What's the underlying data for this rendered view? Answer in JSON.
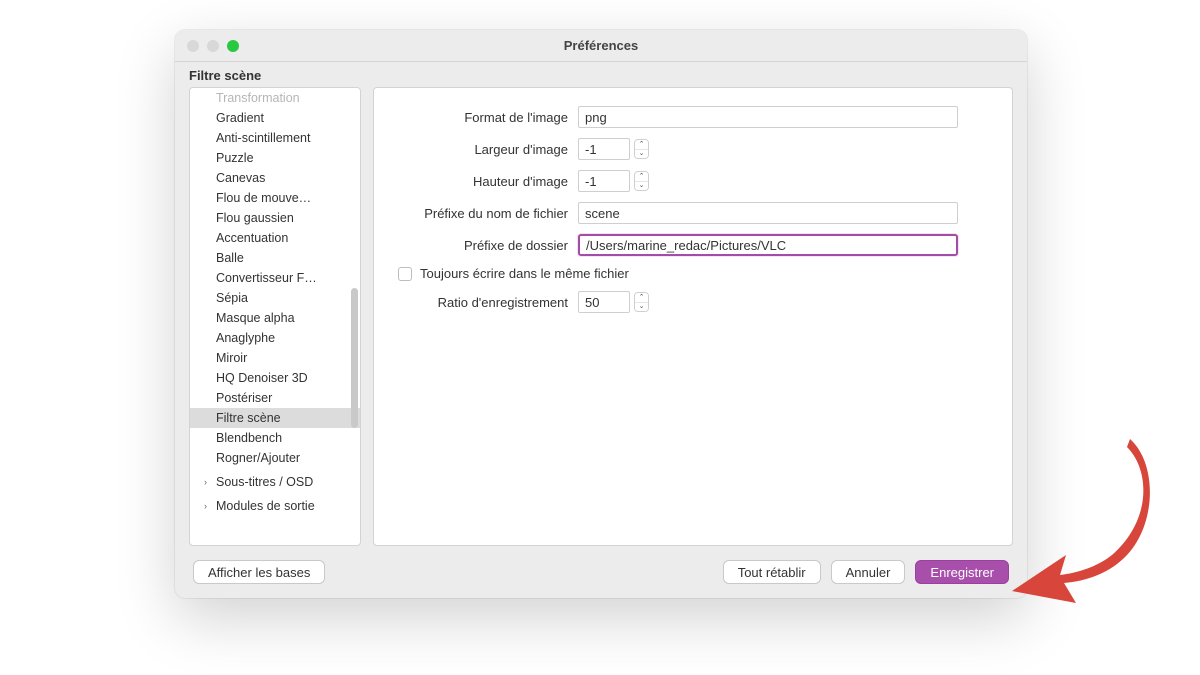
{
  "window": {
    "title": "Préférences",
    "panel_title": "Filtre scène"
  },
  "sidebar": {
    "items": [
      {
        "label": "Transformation",
        "faded": true
      },
      {
        "label": "Gradient"
      },
      {
        "label": "Anti-scintillement"
      },
      {
        "label": "Puzzle"
      },
      {
        "label": "Canevas"
      },
      {
        "label": "Flou de mouve…"
      },
      {
        "label": "Flou gaussien"
      },
      {
        "label": "Accentuation"
      },
      {
        "label": "Balle"
      },
      {
        "label": "Convertisseur F…"
      },
      {
        "label": "Sépia"
      },
      {
        "label": "Masque alpha"
      },
      {
        "label": "Anaglyphe"
      },
      {
        "label": "Miroir"
      },
      {
        "label": "HQ Denoiser 3D"
      },
      {
        "label": "Postériser"
      },
      {
        "label": "Filtre scène",
        "selected": true
      },
      {
        "label": "Blendbench"
      },
      {
        "label": "Rogner/Ajouter"
      }
    ],
    "groups": [
      {
        "label": "Sous-titres / OSD"
      },
      {
        "label": "Modules de sortie"
      }
    ]
  },
  "form": {
    "image_format": {
      "label": "Format de l'image",
      "value": "png"
    },
    "image_width": {
      "label": "Largeur d'image",
      "value": "-1"
    },
    "image_height": {
      "label": "Hauteur d'image",
      "value": "-1"
    },
    "filename_prefix": {
      "label": "Préfixe du nom de fichier",
      "value": "scene"
    },
    "dir_prefix": {
      "label": "Préfixe de dossier",
      "value": "/Users/marine_redac/Pictures/VLC"
    },
    "always_write": {
      "label": "Toujours écrire dans le même fichier",
      "checked": false
    },
    "record_ratio": {
      "label": "Ratio d'enregistrement",
      "value": "50"
    }
  },
  "footer": {
    "show_bases": "Afficher les bases",
    "reset_all": "Tout rétablir",
    "cancel": "Annuler",
    "save": "Enregistrer"
  }
}
